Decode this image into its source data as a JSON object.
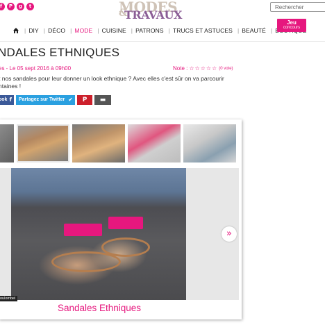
{
  "header": {
    "social_icons": [
      "facebook-icon",
      "pinterest-icon",
      "google-plus-icon",
      "twitter-icon"
    ],
    "logo_line1": "MODES",
    "logo_amp": "&",
    "logo_line2": "TRAVAUX",
    "search_placeholder": "Rechercher",
    "jeu_line1": "Jeu",
    "jeu_line2": "concours"
  },
  "nav": {
    "items": [
      {
        "label": "DIY",
        "active": false
      },
      {
        "label": "DÉCO",
        "active": false
      },
      {
        "label": "MODE",
        "active": true
      },
      {
        "label": "CUISINE",
        "active": false
      },
      {
        "label": "PATRONS",
        "active": false
      },
      {
        "label": "TRUCS ET ASTUCES",
        "active": false
      },
      {
        "label": "BEAUTÉ",
        "active": false
      },
      {
        "label": "BOUTIQUE",
        "active": false
      }
    ]
  },
  "article": {
    "title": "NDALES ETHNIQUES",
    "byline": "es - Le 05 sept 2016 à 09h00",
    "note_label": "Note :",
    "note_stars": "☆☆☆☆☆",
    "note_votes": "(0 vote)",
    "intro": "t nos sandales pour leur donner un look ethnique ? Avec elles c'est sûr on va parcourir ntaines !"
  },
  "share": {
    "facebook": "ook",
    "twitter": "Partagez sur Twitter",
    "icons": [
      "facebook-icon",
      "twitter-icon",
      "pinterest-icon",
      "comment-icon"
    ]
  },
  "gallery": {
    "thumb_count": 5,
    "credit": "oulombel",
    "caption": "Sandales Ethniques",
    "next_icon": "»"
  },
  "colors": {
    "accent": "#e6177e",
    "facebook": "#3b5998",
    "twitter": "#2aa0e0",
    "pinterest": "#cc1f2b"
  }
}
